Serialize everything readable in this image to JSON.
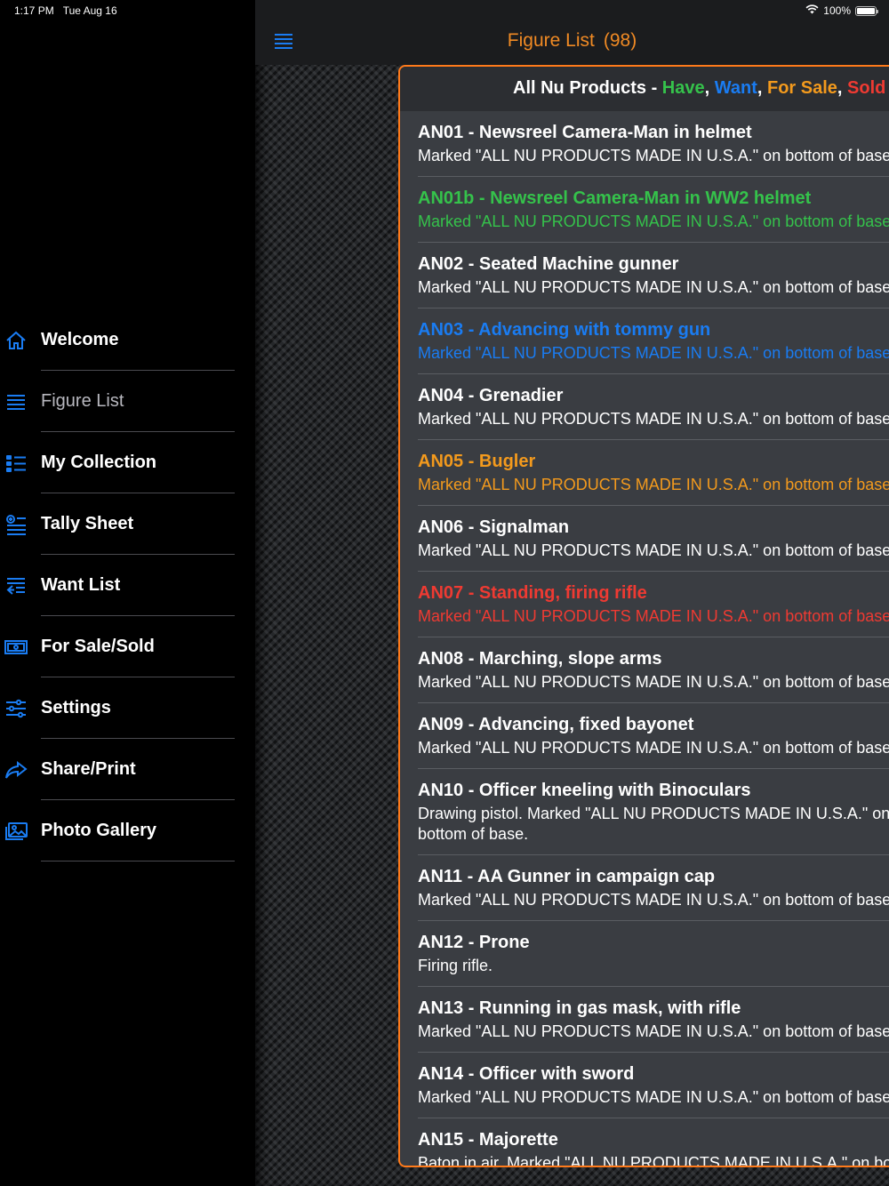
{
  "status_bar": {
    "time": "1:17 PM",
    "date": "Tue Aug 16",
    "battery_text": "100%",
    "battery_level": 1.0
  },
  "sidebar": {
    "items": [
      {
        "label": "Welcome",
        "icon": "house-icon"
      },
      {
        "label": "Figure List",
        "icon": "list-icon",
        "active": true
      },
      {
        "label": "My Collection",
        "icon": "bullet-list-icon"
      },
      {
        "label": "Tally Sheet",
        "icon": "tally-icon"
      },
      {
        "label": "Want List",
        "icon": "want-list-icon"
      },
      {
        "label": "For Sale/Sold",
        "icon": "money-icon"
      },
      {
        "label": "Settings",
        "icon": "sliders-icon"
      },
      {
        "label": "Share/Print",
        "icon": "share-arrow-icon"
      },
      {
        "label": "Photo Gallery",
        "icon": "photo-gallery-icon"
      }
    ]
  },
  "navbar": {
    "title": "Figure List",
    "count": "(98)"
  },
  "panel": {
    "header_prefix": "All Nu Products - ",
    "legend": {
      "have": "Have",
      "want": "Want",
      "for_sale": "For Sale",
      "sold": "Sold",
      "separator": ", "
    }
  },
  "colors": {
    "accent_blue": "#1a7cf2",
    "accent_orange": "#f08a24",
    "have": "#35c24b",
    "want": "#1a7cf2",
    "for_sale": "#f39a1d",
    "sold": "#ef3a32"
  },
  "figures": [
    {
      "title": "AN01 - Newsreel Camera-Man in helmet",
      "desc": "Marked \"ALL NU PRODUCTS MADE IN U.S.A.\" on bottom of base.",
      "status": ""
    },
    {
      "title": "AN01b - Newsreel Camera-Man in WW2 helmet",
      "desc": "Marked \"ALL NU PRODUCTS MADE IN U.S.A.\" on bottom of base.",
      "status": "have"
    },
    {
      "title": "AN02 - Seated Machine gunner",
      "desc": "Marked \"ALL NU PRODUCTS MADE IN U.S.A.\" on bottom of base.",
      "status": ""
    },
    {
      "title": "AN03 - Advancing with tommy gun",
      "desc": "Marked \"ALL NU PRODUCTS MADE IN U.S.A.\" on bottom of base.",
      "status": "want"
    },
    {
      "title": "AN04 - Grenadier",
      "desc": "Marked \"ALL NU PRODUCTS MADE IN U.S.A.\" on bottom of base.",
      "status": ""
    },
    {
      "title": "AN05 - Bugler",
      "desc": "Marked \"ALL NU PRODUCTS MADE IN U.S.A.\" on bottom of base.",
      "status": "forsale"
    },
    {
      "title": "AN06 - Signalman",
      "desc": "Marked \"ALL NU PRODUCTS MADE IN U.S.A.\" on bottom of base.",
      "status": ""
    },
    {
      "title": "AN07 - Standing, firing rifle",
      "desc": "Marked \"ALL NU PRODUCTS MADE IN U.S.A.\" on bottom of base.",
      "status": "sold"
    },
    {
      "title": "AN08 - Marching, slope arms",
      "desc": "Marked \"ALL NU PRODUCTS MADE IN U.S.A.\" on bottom of base.",
      "status": ""
    },
    {
      "title": "AN09 - Advancing, fixed bayonet",
      "desc": "Marked \"ALL NU PRODUCTS MADE IN U.S.A.\" on bottom of base.",
      "status": ""
    },
    {
      "title": "AN10 - Officer kneeling with Binoculars",
      "desc": "Drawing pistol. Marked \"ALL NU PRODUCTS MADE IN U.S.A.\" on bottom of base.",
      "status": "",
      "tall": true
    },
    {
      "title": "AN11 - AA Gunner in campaign cap",
      "desc": "Marked \"ALL NU PRODUCTS MADE IN U.S.A.\" on bottom of base.",
      "status": ""
    },
    {
      "title": "AN12 - Prone",
      "desc": "Firing rifle.",
      "status": ""
    },
    {
      "title": "AN13 - Running in gas mask, with rifle",
      "desc": "Marked \"ALL NU PRODUCTS MADE IN U.S.A.\" on bottom of base.",
      "status": ""
    },
    {
      "title": "AN14 - Officer with sword",
      "desc": "Marked \"ALL NU PRODUCTS MADE IN U.S.A.\" on bottom of base.",
      "status": ""
    },
    {
      "title": "AN15 - Majorette",
      "desc": "Baton in air. Marked \"ALL NU PRODUCTS MADE IN U.S.A.\" on bottom of base.",
      "status": ""
    }
  ]
}
